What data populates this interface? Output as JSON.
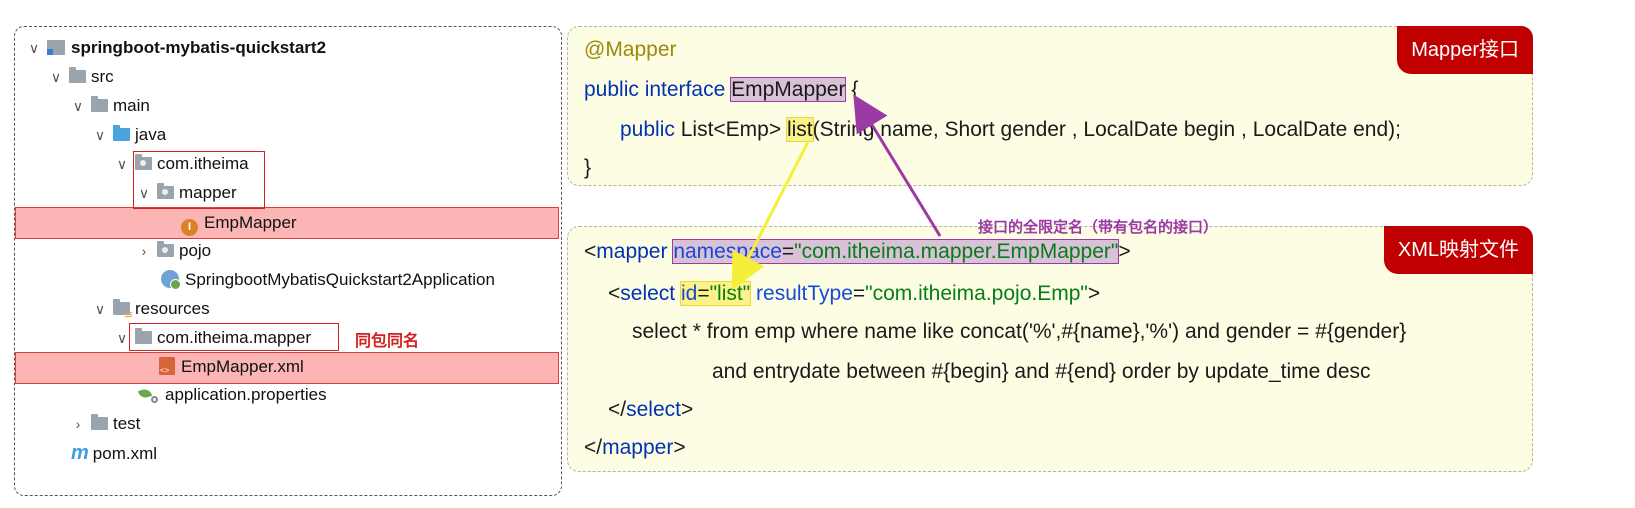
{
  "tree": {
    "root": "springboot-mybatis-quickstart2",
    "src": "src",
    "main": "main",
    "java": "java",
    "pkg_itheima": "com.itheima",
    "pkg_mapper": "mapper",
    "emp_mapper": "EmpMapper",
    "pojo": "pojo",
    "app_class": "SpringbootMybatisQuickstart2Application",
    "resources": "resources",
    "res_pkg": "com.itheima.mapper",
    "xml_file": "EmpMapper.xml",
    "properties": "application.properties",
    "test": "test",
    "pom": "pom.xml",
    "same_pkg_note": "同包同名"
  },
  "interface_panel": {
    "tag": "Mapper接口",
    "annotation": "@Mapper",
    "kw_public_interface": "public interface",
    "interface_name": "EmpMapper",
    "open_brace": "{",
    "kw_public": "public",
    "return_type": "List<Emp>",
    "method_name": "list",
    "params": "(String name, Short gender , LocalDate begin , LocalDate end);",
    "close_brace": "}"
  },
  "xml_panel": {
    "tag": "XML映射文件",
    "lt": "<",
    "mapper_tag": "mapper",
    "namespace_attr": "namespace",
    "eq": "=",
    "namespace_val": "\"com.itheima.mapper.EmpMapper\"",
    "gt": ">",
    "select_tag": "select",
    "id_attr": "id",
    "id_val": "\"list\"",
    "result_attr": "resultType",
    "result_val": "\"com.itheima.pojo.Emp\"",
    "sql_line1": "select * from emp where name like concat('%',#{name},'%') and gender = #{gender}",
    "sql_line2": "and entrydate between #{begin} and #{end} order by update_time desc",
    "close_select_open": "</",
    "close_mapper_open": "</"
  },
  "arrow_label": "接口的全限定名（带有包名的接口）",
  "colors": {
    "tag_bg": "#c00000",
    "panel_bg": "#fdfde4",
    "purple": "#9b3aa5",
    "yellow": "#f5ef3a",
    "red": "#d42020"
  }
}
